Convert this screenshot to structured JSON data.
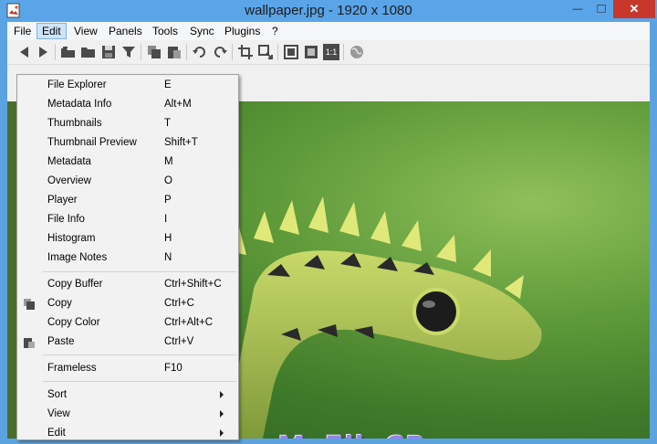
{
  "window": {
    "title": "wallpaper.jpg - 1920 x 1080",
    "minimize_glyph": "—",
    "maximize_glyph": "□",
    "close_glyph": "✕"
  },
  "menubar": {
    "items": [
      "File",
      "Edit",
      "View",
      "Panels",
      "Tools",
      "Sync",
      "Plugins",
      "?"
    ],
    "active": "Edit"
  },
  "toolbar": {
    "icons": [
      "back-icon",
      "forward-icon",
      "open-folder-icon",
      "folder-icon",
      "save-icon",
      "filter-icon",
      "copy-icon",
      "paste-icon",
      "rotate-left-icon",
      "rotate-right-icon",
      "crop-icon",
      "resize-icon",
      "fit-window-icon",
      "fullscreen-icon",
      "actual-size-icon",
      "globe-icon"
    ],
    "actual_size_label": "1:1"
  },
  "dropdown": {
    "groups": [
      [
        {
          "label": "File Explorer",
          "shortcut": "E"
        },
        {
          "label": "Metadata Info",
          "shortcut": "Alt+M"
        },
        {
          "label": "Thumbnails",
          "shortcut": "T"
        },
        {
          "label": "Thumbnail Preview",
          "shortcut": "Shift+T"
        },
        {
          "label": "Metadata",
          "shortcut": "M"
        },
        {
          "label": "Overview",
          "shortcut": "O"
        },
        {
          "label": "Player",
          "shortcut": "P"
        },
        {
          "label": "File Info",
          "shortcut": "I"
        },
        {
          "label": "Histogram",
          "shortcut": "H"
        },
        {
          "label": "Image Notes",
          "shortcut": "N"
        }
      ],
      [
        {
          "label": "Copy Buffer",
          "shortcut": "Ctrl+Shift+C"
        },
        {
          "label": "Copy",
          "shortcut": "Ctrl+C",
          "icon": "copy-icon"
        },
        {
          "label": "Copy Color",
          "shortcut": "Ctrl+Alt+C"
        },
        {
          "label": "Paste",
          "shortcut": "Ctrl+V",
          "icon": "paste-icon"
        }
      ],
      [
        {
          "label": "Frameless",
          "shortcut": "F10"
        }
      ],
      [
        {
          "label": "Sort",
          "submenu": true
        },
        {
          "label": "View",
          "submenu": true
        },
        {
          "label": "Edit",
          "submenu": true
        }
      ]
    ]
  },
  "watermark": "www.MyFileCR.com",
  "colors": {
    "titlebar": "#5aa5e8",
    "close_button": "#c7372b",
    "menu_active": "#cce4f7",
    "menu_background": "#f2f2f2"
  }
}
